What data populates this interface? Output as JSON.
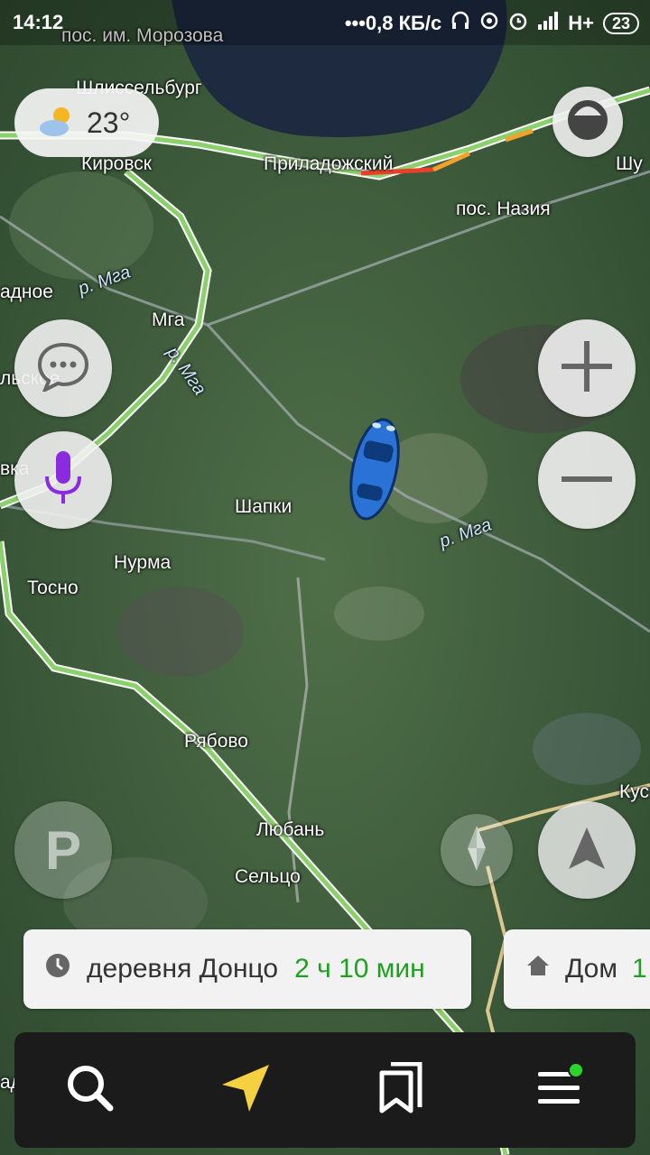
{
  "status_bar": {
    "time": "14:12",
    "network_speed": "•••0,8 КБ/с",
    "network_type": "H+",
    "battery": "23",
    "icons": [
      "headphones-icon",
      "hotspot-icon",
      "alarm-icon",
      "signal-icon"
    ]
  },
  "weather": {
    "temperature": "23°",
    "icon": "partly-cloudy-icon"
  },
  "map": {
    "place_labels": {
      "morozova": "пос. им. Морозова",
      "shlisselburg": "Шлиссельбург",
      "kirovsk": "Кировск",
      "priladozhsky": "Приладожский",
      "shu": "Шу",
      "nazia": "пос. Назия",
      "adnoe": "адное",
      "mga": "Мга",
      "lskoe": "льское",
      "vka": "вка",
      "shapki": "Шапки",
      "nurma": "Нурма",
      "tosno": "Тосно",
      "ryabovo": "Рябово",
      "luban": "Любань",
      "seltso": "Сельцо",
      "kus": "Кус",
      "ad": "ад"
    },
    "river_labels": [
      "р. Мга",
      "р. Мга",
      "р. Мга"
    ]
  },
  "controls": {
    "layers": "layers-icon",
    "zoom_in": "plus-icon",
    "zoom_out": "minus-icon",
    "messages": "chat-icon",
    "voice": "microphone-icon",
    "parking": "P",
    "compass": "compass-icon",
    "locate": "navigation-arrow-icon"
  },
  "routes": [
    {
      "destination": "деревня Донцо",
      "eta": "2 ч 10 мин",
      "icon": "clock-icon"
    },
    {
      "destination": "Дом",
      "eta": "1",
      "icon": "home-icon"
    }
  ],
  "bottom_nav": {
    "items": [
      "search-icon",
      "navigator-arrow-icon",
      "bookmarks-icon",
      "menu-icon"
    ],
    "menu_badge_color": "#2bd42b"
  },
  "colors": {
    "road": "#8bd16b",
    "traffic_red": "#e8412b",
    "traffic_orange": "#f2a12b",
    "accent": "#8a2be2",
    "car": "#2a72d6"
  }
}
